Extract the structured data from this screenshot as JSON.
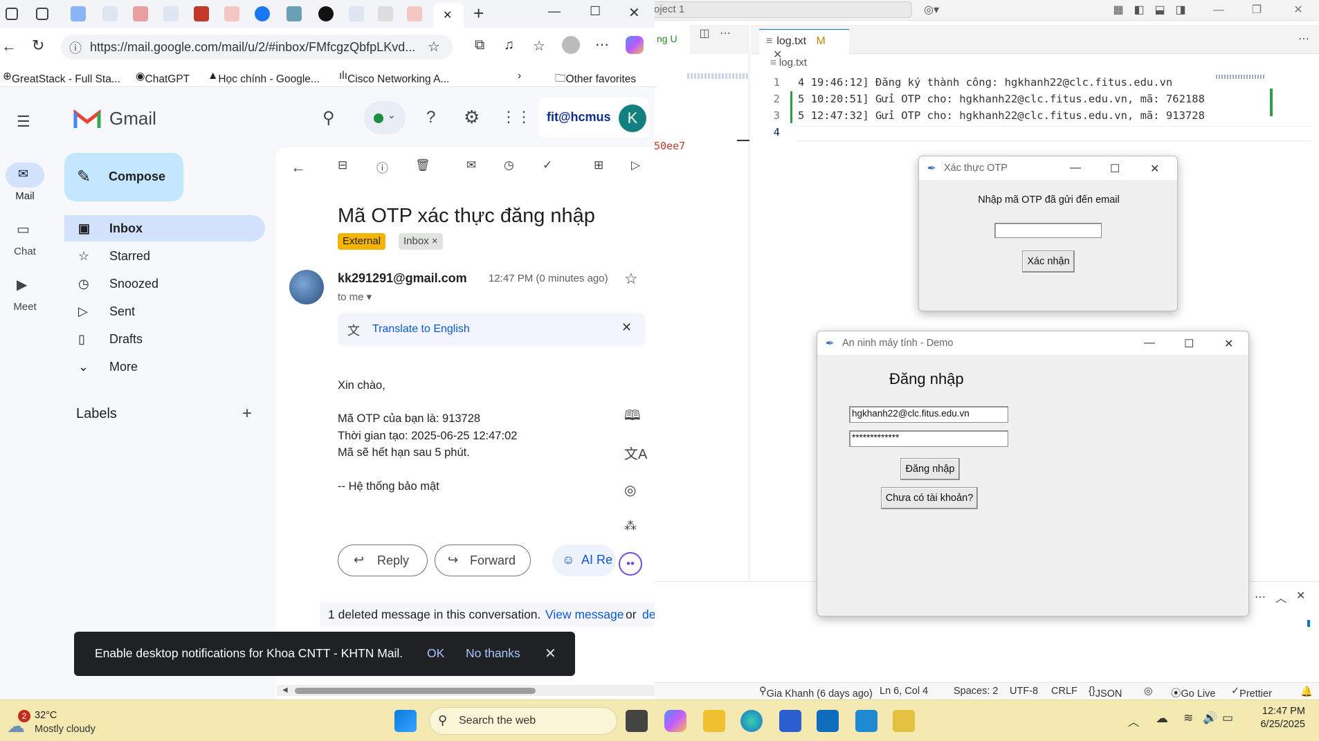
{
  "browser": {
    "url": "https://mail.google.com/mail/u/2/#inbox/FMfcgzQbfpLKvd...",
    "bookmarks": [
      "GreatStack - Full Sta...",
      "ChatGPT",
      "Học chính - Google...",
      "Cisco Networking A...",
      "Other favorites"
    ]
  },
  "gmail": {
    "logo_text": "Gmail",
    "rail": [
      "Mail",
      "Chat",
      "Meet"
    ],
    "compose": "Compose",
    "nav": [
      "Inbox",
      "Starred",
      "Snoozed",
      "Sent",
      "Drafts",
      "More"
    ],
    "labels_heading": "Labels",
    "org_logo": "fit@hcmus",
    "avatar_letter": "K",
    "subject": "Mã OTP xác thực đăng nhập",
    "chips": [
      "External",
      "Inbox"
    ],
    "sender": "kk291291@gmail.com",
    "time": "12:47 PM (0 minutes ago)",
    "to": "to me",
    "translate": "Translate to English",
    "body": [
      "Xin chào,",
      "Mã OTP của bạn là: 913728",
      "Thời gian tạo: 2025-06-25 12:47:02",
      "Mã sẽ hết hạn sau 5 phút.",
      "-- Hệ thống bảo mật"
    ],
    "reply": "Reply",
    "forward": "Forward",
    "ai_reply": "AI Re",
    "deleted_note": "1 deleted message in this conversation.",
    "view_message": "View message",
    "or": "or",
    "de": "de",
    "toast": {
      "text": "Enable desktop notifications for Khoa CNTT - KHTN Mail.",
      "ok": "OK",
      "no": "No thanks"
    }
  },
  "vscode": {
    "search": "roject 1",
    "panel_left": [
      "ng U"
    ],
    "orphan": "50ee7",
    "tab": "log.txt",
    "tab_badge": "M",
    "breadcrumb": "log.txt",
    "lines": [
      {
        "n": "1",
        "t": "4 19:46:12] Đăng ký thành công: hgkhanh22@clc.fitus.edu.vn"
      },
      {
        "n": "2",
        "t": "5 10:20:51] Gửi OTP cho: hgkhanh22@clc.fitus.edu.vn, mã: 762188"
      },
      {
        "n": "3",
        "t": "5 12:47:32] Gửi OTP cho: hgkhanh22@clc.fitus.edu.vn, mã: 913728"
      },
      {
        "n": "4",
        "t": ""
      }
    ],
    "status": {
      "git": "Gia Khanh (6 days ago)",
      "pos": "Ln 6, Col 4",
      "spaces": "Spaces: 2",
      "enc": "UTF-8",
      "eol": "CRLF",
      "lang": "JSON",
      "live": "Go Live",
      "prettier": "Prettier"
    }
  },
  "otp_window": {
    "title": "Xác thực OTP",
    "prompt": "Nhập mã OTP đã gửi đến email",
    "input_value": "",
    "button": "Xác nhận"
  },
  "login_window": {
    "title": "An ninh máy tính - Demo",
    "heading": "Đăng nhập",
    "email": "hgkhanh22@clc.fitus.edu.vn",
    "password": "*************",
    "login_button": "Đăng nhập",
    "register_button": "Chưa có tài khoản?"
  },
  "taskbar": {
    "weather_badge": "2",
    "temp": "32°C",
    "condition": "Mostly cloudy",
    "search": "Search the web",
    "time": "12:47 PM",
    "date": "6/25/2025"
  }
}
